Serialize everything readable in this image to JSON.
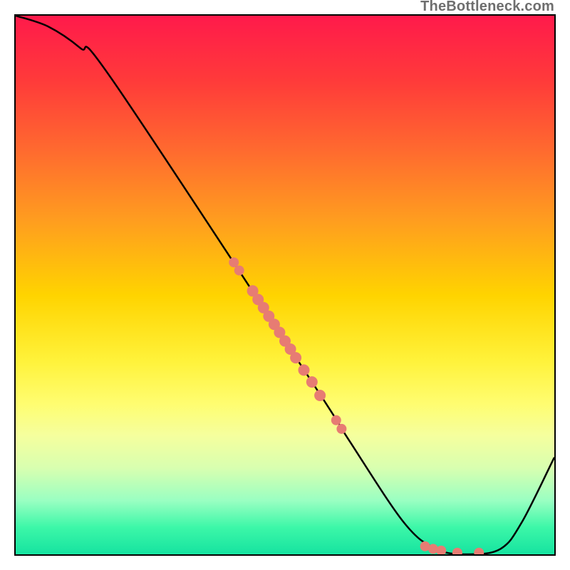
{
  "watermark": "TheBottleneck.com",
  "colors": {
    "dot": "#e77c73",
    "curve": "#000000"
  },
  "chart_data": {
    "type": "line",
    "title": "",
    "xlabel": "",
    "ylabel": "",
    "xlim": [
      0,
      100
    ],
    "ylim": [
      0,
      100
    ],
    "grid": false,
    "legend": false,
    "series": [
      {
        "name": "curve",
        "x": [
          0,
          6,
          12,
          18,
          55,
          62,
          72,
          78,
          84,
          90,
          94,
          100
        ],
        "y": [
          100,
          98,
          94,
          88,
          32,
          21,
          6,
          1,
          0,
          1,
          6,
          18
        ]
      }
    ],
    "scatter": {
      "name": "dots-on-curve",
      "points": [
        {
          "x": 40.5,
          "y": 54.2,
          "r": 7
        },
        {
          "x": 41.5,
          "y": 52.7,
          "r": 7
        },
        {
          "x": 44.0,
          "y": 48.9,
          "r": 8
        },
        {
          "x": 45.0,
          "y": 47.3,
          "r": 8
        },
        {
          "x": 46.0,
          "y": 45.8,
          "r": 8
        },
        {
          "x": 47.0,
          "y": 44.2,
          "r": 8
        },
        {
          "x": 48.0,
          "y": 42.7,
          "r": 8
        },
        {
          "x": 49.0,
          "y": 41.2,
          "r": 8
        },
        {
          "x": 50.0,
          "y": 39.6,
          "r": 8
        },
        {
          "x": 51.0,
          "y": 38.1,
          "r": 8
        },
        {
          "x": 52.0,
          "y": 36.5,
          "r": 8
        },
        {
          "x": 53.5,
          "y": 34.2,
          "r": 8
        },
        {
          "x": 55.0,
          "y": 32.0,
          "r": 8
        },
        {
          "x": 56.5,
          "y": 29.5,
          "r": 8
        },
        {
          "x": 59.5,
          "y": 24.9,
          "r": 7
        },
        {
          "x": 60.5,
          "y": 23.3,
          "r": 7
        },
        {
          "x": 76.0,
          "y": 1.5,
          "r": 7
        },
        {
          "x": 77.5,
          "y": 1.0,
          "r": 7
        },
        {
          "x": 79.0,
          "y": 0.7,
          "r": 7
        },
        {
          "x": 82.0,
          "y": 0.3,
          "r": 7
        },
        {
          "x": 86.0,
          "y": 0.3,
          "r": 7
        }
      ]
    }
  }
}
